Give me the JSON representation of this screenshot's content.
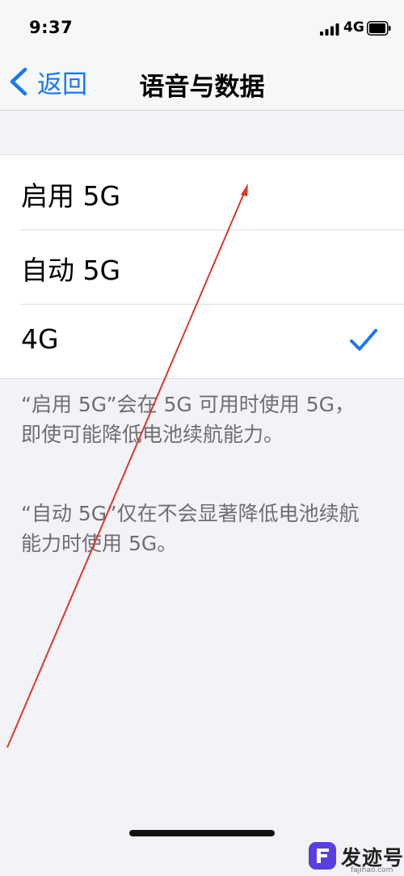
{
  "status_bar": {
    "time": "9:37",
    "network": "4G",
    "signal_bars": 4
  },
  "nav": {
    "back_label": "返回",
    "title": "语音与数据"
  },
  "options": [
    {
      "label": "启用 5G",
      "selected": false
    },
    {
      "label": "自动 5G",
      "selected": false
    },
    {
      "label": "4G",
      "selected": true
    }
  ],
  "footer_notes": [
    "“启用 5G”会在 5G 可用时使用 5G，即使可能降低电池续航能力。",
    "“自动 5G”仅在不会显著降低电池续航能力时使用 5G。"
  ],
  "watermark": {
    "brand": "发迹号",
    "url": "fajihao.com"
  },
  "colors": {
    "accent": "#1878f0",
    "annotation": "#d93a2e"
  }
}
